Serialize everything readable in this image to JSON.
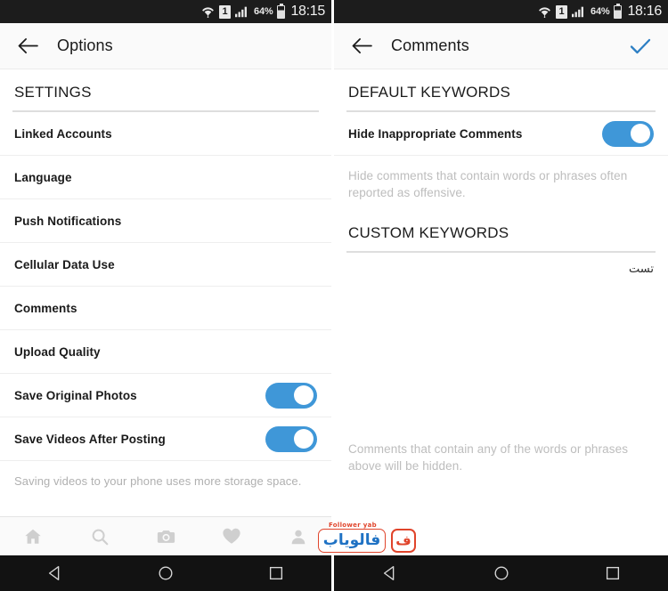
{
  "left_screen": {
    "status_bar": {
      "wifi_icon": "wifi-icon",
      "sim_label": "1",
      "signal_icon": "signal-bars-icon",
      "battery_percent": "64%",
      "battery_icon": "battery-icon",
      "clock": "18:15"
    },
    "app_bar": {
      "back_icon": "back-arrow-icon",
      "title": "Options"
    },
    "section_header": "SETTINGS",
    "rows": [
      {
        "label": "Linked Accounts",
        "toggle": null
      },
      {
        "label": "Language",
        "toggle": null
      },
      {
        "label": "Push Notifications",
        "toggle": null
      },
      {
        "label": "Cellular Data Use",
        "toggle": null
      },
      {
        "label": "Comments",
        "toggle": null
      },
      {
        "label": "Upload Quality",
        "toggle": null
      },
      {
        "label": "Save Original Photos",
        "toggle": "on"
      },
      {
        "label": "Save Videos After Posting",
        "toggle": "on"
      }
    ],
    "helper_text": "Saving videos to your phone uses more storage space.",
    "tab_bar": [
      {
        "name": "tab-home",
        "icon": "home-icon"
      },
      {
        "name": "tab-search",
        "icon": "search-icon"
      },
      {
        "name": "tab-camera",
        "icon": "camera-icon"
      },
      {
        "name": "tab-activity",
        "icon": "heart-icon"
      },
      {
        "name": "tab-profile",
        "icon": "profile-icon"
      }
    ],
    "nav_bar": [
      {
        "name": "android-back",
        "icon": "triangle-back-icon"
      },
      {
        "name": "android-home",
        "icon": "circle-home-icon"
      },
      {
        "name": "android-recents",
        "icon": "square-recents-icon"
      }
    ]
  },
  "right_screen": {
    "status_bar": {
      "wifi_icon": "wifi-icon",
      "sim_label": "1",
      "signal_icon": "signal-bars-icon",
      "battery_percent": "64%",
      "battery_icon": "battery-icon",
      "clock": "18:16"
    },
    "app_bar": {
      "back_icon": "back-arrow-icon",
      "title": "Comments",
      "confirm_icon": "checkmark-icon"
    },
    "default_section_header": "DEFAULT KEYWORDS",
    "default_row": {
      "label": "Hide Inappropriate Comments",
      "toggle": "on"
    },
    "default_helper_text": "Hide comments that contain words or phrases often reported as offensive.",
    "custom_section_header": "CUSTOM KEYWORDS",
    "custom_keywords": [
      "تست"
    ],
    "custom_helper_text": "Comments that contain any of the words or phrases above will be hidden.",
    "nav_bar": [
      {
        "name": "android-back",
        "icon": "triangle-back-icon"
      },
      {
        "name": "android-home",
        "icon": "circle-home-icon"
      },
      {
        "name": "android-recents",
        "icon": "square-recents-icon"
      }
    ]
  },
  "watermark": {
    "tagline": "Follower yab",
    "brand": "فالویاب",
    "badge": "ف",
    "accent_red": "#e0442b",
    "accent_blue": "#1f72c4"
  },
  "colors": {
    "toggle_on": "#3f97d8",
    "checkmark_blue": "#2d7fc4",
    "status_bar_bg": "#1c1c1c",
    "app_bar_bg": "#fafafa",
    "nav_bar_bg": "#121212",
    "helper_text_gray": "#b0b0b0"
  }
}
